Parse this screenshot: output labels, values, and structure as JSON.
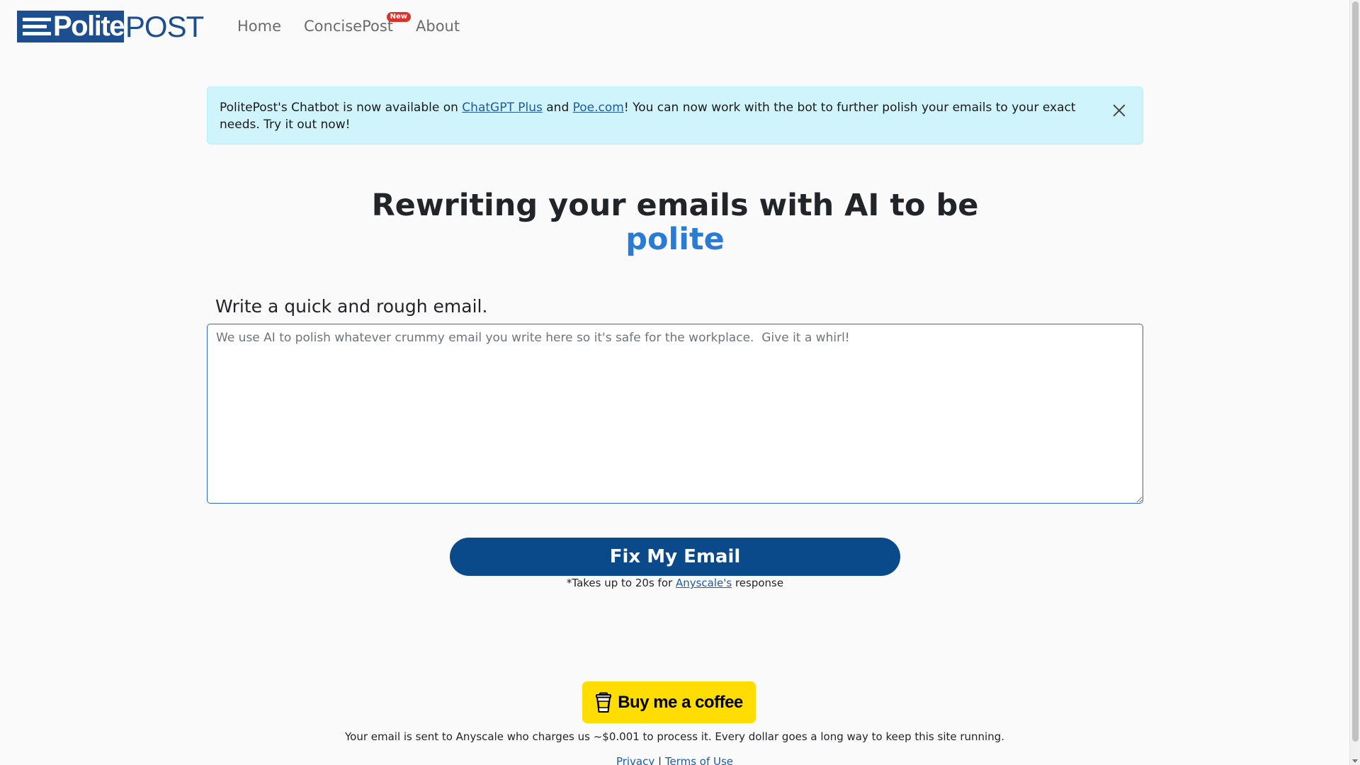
{
  "navbar": {
    "logo_polite": "Polite",
    "logo_post": "POST",
    "links": [
      {
        "label": "Home"
      },
      {
        "label": "ConcisePost",
        "badge": "New"
      },
      {
        "label": "About"
      }
    ]
  },
  "alert": {
    "text_before": "PolitePost's Chatbot is now available on ",
    "link1": "ChatGPT Plus",
    "text_and": " and ",
    "link2": "Poe.com",
    "text_after": "! You can now work with the bot to further polish your emails to your exact needs. Try it out now!"
  },
  "hero": {
    "line1": "Rewriting your emails with AI to be",
    "accent": "polite"
  },
  "form": {
    "label": "Write a quick and rough email.",
    "placeholder": "We use AI to polish whatever crummy email you write here so it's safe for the workplace.  Give it a whirl!",
    "value": "",
    "button": "Fix My Email",
    "note_before": "*Takes up to 20s for ",
    "note_link": "Anyscale's",
    "note_after": " response"
  },
  "support": {
    "coffee_label": "Buy me a coffee",
    "note": "Your email is sent to Anyscale who charges us ~$0.001 to process it. Every dollar goes a long way to keep this site running."
  },
  "footer": {
    "privacy": "Privacy",
    "separator": " | ",
    "terms": "Terms of Use"
  },
  "colors": {
    "brand": "#1d4e8f",
    "accent": "#2a7bd4",
    "button": "#0a4a8a",
    "alert_bg": "#cff4fc",
    "coffee": "#ffdd00"
  }
}
